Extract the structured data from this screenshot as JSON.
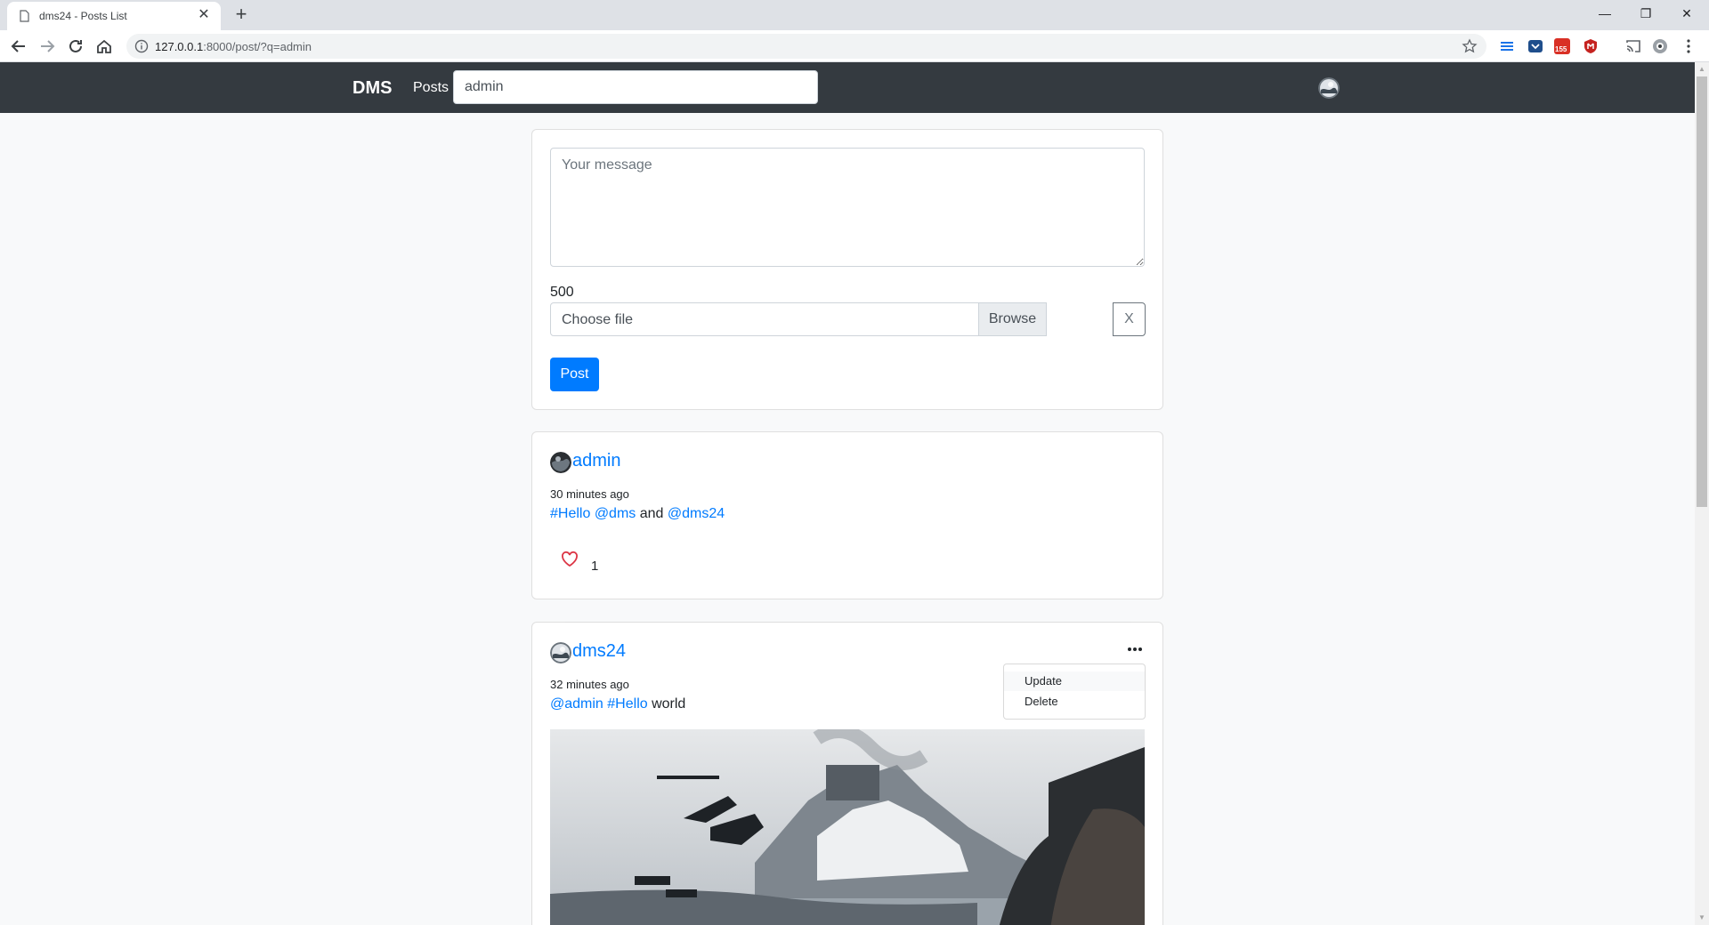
{
  "browser": {
    "tab_title": "dms24 - Posts List",
    "url_host": "127.0.0.1",
    "url_path": ":8000/post/?q=admin",
    "extension_badge": "155"
  },
  "navbar": {
    "brand": "DMS",
    "posts_link": "Posts",
    "search_value": "admin"
  },
  "compose": {
    "placeholder": "Your message",
    "char_count": "500",
    "file_label": "Choose file",
    "browse_label": "Browse",
    "clear_label": "X",
    "post_label": "Post"
  },
  "posts": [
    {
      "username": "admin",
      "time": "30 minutes ago",
      "content": [
        {
          "text": "#Hello",
          "link": true
        },
        {
          "text": " ",
          "link": false
        },
        {
          "text": "@dms",
          "link": true
        },
        {
          "text": " and ",
          "link": false
        },
        {
          "text": "@dms24",
          "link": true
        }
      ],
      "likes": "1"
    },
    {
      "username": "dms24",
      "time": "32 minutes ago",
      "content": [
        {
          "text": "@admin",
          "link": true
        },
        {
          "text": " ",
          "link": false
        },
        {
          "text": "#Hello",
          "link": true
        },
        {
          "text": " world",
          "link": false
        }
      ],
      "menu": [
        "Update",
        "Delete"
      ]
    }
  ],
  "colors": {
    "navbar_bg": "#343a40",
    "primary": "#007bff",
    "like_red": "#dc3545"
  }
}
